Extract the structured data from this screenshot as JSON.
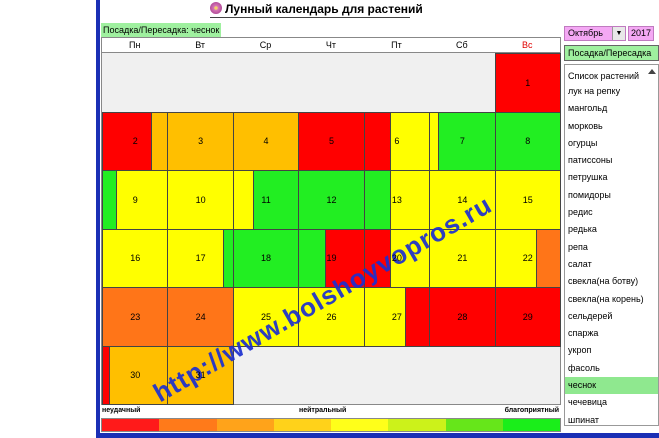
{
  "title": "Лунный календарь для растений",
  "current_plant": "Посадка/Пересадка: чеснок",
  "weekdays": [
    "Пн",
    "Вт",
    "Ср",
    "Чт",
    "Пт",
    "Сб",
    "Вс"
  ],
  "month": "Октябрь",
  "year": "2017",
  "mode_button": "Посадка/Пересадка",
  "plant_list": {
    "header": "Список растений",
    "items": [
      "лук на репку",
      "мангольд",
      "морковь",
      "огурцы",
      "патиссоны",
      "петрушка",
      "помидоры",
      "редис",
      "редька",
      "репа",
      "салат",
      "свекла(на ботву)",
      "свекла(на корень)",
      "сельдерей",
      "спаржа",
      "укроп",
      "фасоль",
      "чеснок",
      "чечевица",
      "шпинат"
    ],
    "selected": "чеснок"
  },
  "legend": {
    "bad": "неудачный",
    "neutral": "нейтральный",
    "good": "благоприятный",
    "scale_colors": [
      "#ff1a1a",
      "#ff7a1a",
      "#ffa31a",
      "#ffd21a",
      "#ffff1a",
      "#ccf21a",
      "#66e61a",
      "#1aee1a"
    ]
  },
  "colors": {
    "red": "#ff0000",
    "orange": "#ff7518",
    "amber": "#ffbf00",
    "yellow": "#ffff00",
    "green": "#22ee22",
    "watermark": "#1c2fd0"
  },
  "days": [
    {
      "label": "1",
      "col": 6,
      "row": 0,
      "segments": [
        {
          "color": "red",
          "w": 1
        }
      ]
    },
    {
      "label": "2",
      "col": 0,
      "row": 1,
      "segments": [
        {
          "color": "red",
          "w": 0.74
        },
        {
          "color": "amber",
          "w": 0.26
        }
      ]
    },
    {
      "label": "3",
      "col": 1,
      "row": 1,
      "segments": [
        {
          "color": "amber",
          "w": 1
        }
      ]
    },
    {
      "label": "4",
      "col": 2,
      "row": 1,
      "segments": [
        {
          "color": "amber",
          "w": 1
        }
      ]
    },
    {
      "label": "5",
      "col": 3,
      "row": 1,
      "segments": [
        {
          "color": "red",
          "w": 1
        }
      ]
    },
    {
      "label": "6",
      "col": 4,
      "row": 1,
      "segments": [
        {
          "color": "red",
          "w": 0.4
        },
        {
          "color": "yellow",
          "w": 0.6
        }
      ]
    },
    {
      "label": "7",
      "col": 5,
      "row": 1,
      "segments": [
        {
          "color": "yellow",
          "w": 0.12
        },
        {
          "color": "green",
          "w": 0.88
        }
      ]
    },
    {
      "label": "8",
      "col": 6,
      "row": 1,
      "segments": [
        {
          "color": "green",
          "w": 1
        }
      ]
    },
    {
      "label": "9",
      "col": 0,
      "row": 2,
      "segments": [
        {
          "color": "green",
          "w": 0.2
        },
        {
          "color": "yellow",
          "w": 0.8
        }
      ]
    },
    {
      "label": "10",
      "col": 1,
      "row": 2,
      "segments": [
        {
          "color": "yellow",
          "w": 1
        }
      ]
    },
    {
      "label": "11",
      "col": 2,
      "row": 2,
      "segments": [
        {
          "color": "yellow",
          "w": 0.3
        },
        {
          "color": "green",
          "w": 0.7
        }
      ]
    },
    {
      "label": "12",
      "col": 3,
      "row": 2,
      "segments": [
        {
          "color": "green",
          "w": 1
        }
      ]
    },
    {
      "label": "13",
      "col": 4,
      "row": 2,
      "segments": [
        {
          "color": "green",
          "w": 0.4
        },
        {
          "color": "yellow",
          "w": 0.6
        }
      ]
    },
    {
      "label": "14",
      "col": 5,
      "row": 2,
      "segments": [
        {
          "color": "yellow",
          "w": 1
        }
      ]
    },
    {
      "label": "15",
      "col": 6,
      "row": 2,
      "segments": [
        {
          "color": "yellow",
          "w": 1
        }
      ]
    },
    {
      "label": "16",
      "col": 0,
      "row": 3,
      "segments": [
        {
          "color": "yellow",
          "w": 1
        }
      ]
    },
    {
      "label": "17",
      "col": 1,
      "row": 3,
      "segments": [
        {
          "color": "yellow",
          "w": 0.85
        },
        {
          "color": "green",
          "w": 0.15
        }
      ]
    },
    {
      "label": "18",
      "col": 2,
      "row": 3,
      "segments": [
        {
          "color": "green",
          "w": 1
        }
      ]
    },
    {
      "label": "19",
      "col": 3,
      "row": 3,
      "segments": [
        {
          "color": "green",
          "w": 0.4
        },
        {
          "color": "red",
          "w": 0.6
        }
      ]
    },
    {
      "label": "20",
      "col": 4,
      "row": 3,
      "segments": [
        {
          "color": "red",
          "w": 0.4
        },
        {
          "color": "yellow",
          "w": 0.6
        }
      ]
    },
    {
      "label": "21",
      "col": 5,
      "row": 3,
      "segments": [
        {
          "color": "yellow",
          "w": 1
        }
      ]
    },
    {
      "label": "22",
      "col": 6,
      "row": 3,
      "segments": [
        {
          "color": "yellow",
          "w": 0.62
        },
        {
          "color": "orange",
          "w": 0.38
        }
      ]
    },
    {
      "label": "23",
      "col": 0,
      "row": 4,
      "segments": [
        {
          "color": "orange",
          "w": 1
        }
      ]
    },
    {
      "label": "24",
      "col": 1,
      "row": 4,
      "segments": [
        {
          "color": "orange",
          "w": 1
        }
      ]
    },
    {
      "label": "25",
      "col": 2,
      "row": 4,
      "segments": [
        {
          "color": "yellow",
          "w": 1
        }
      ]
    },
    {
      "label": "26",
      "col": 3,
      "row": 4,
      "segments": [
        {
          "color": "yellow",
          "w": 1
        }
      ]
    },
    {
      "label": "27",
      "col": 4,
      "row": 4,
      "segments": [
        {
          "color": "yellow",
          "w": 0.62
        },
        {
          "color": "red",
          "w": 0.38
        }
      ]
    },
    {
      "label": "28",
      "col": 5,
      "row": 4,
      "segments": [
        {
          "color": "red",
          "w": 1
        }
      ]
    },
    {
      "label": "29",
      "col": 6,
      "row": 4,
      "segments": [
        {
          "color": "red",
          "w": 1
        }
      ]
    },
    {
      "label": "30",
      "col": 0,
      "row": 5,
      "segments": [
        {
          "color": "red",
          "w": 0.1
        },
        {
          "color": "amber",
          "w": 0.9
        }
      ]
    },
    {
      "label": "31",
      "col": 1,
      "row": 5,
      "segments": [
        {
          "color": "amber",
          "w": 1
        }
      ]
    }
  ],
  "watermark": "http://www.bolshoyvopros.ru"
}
